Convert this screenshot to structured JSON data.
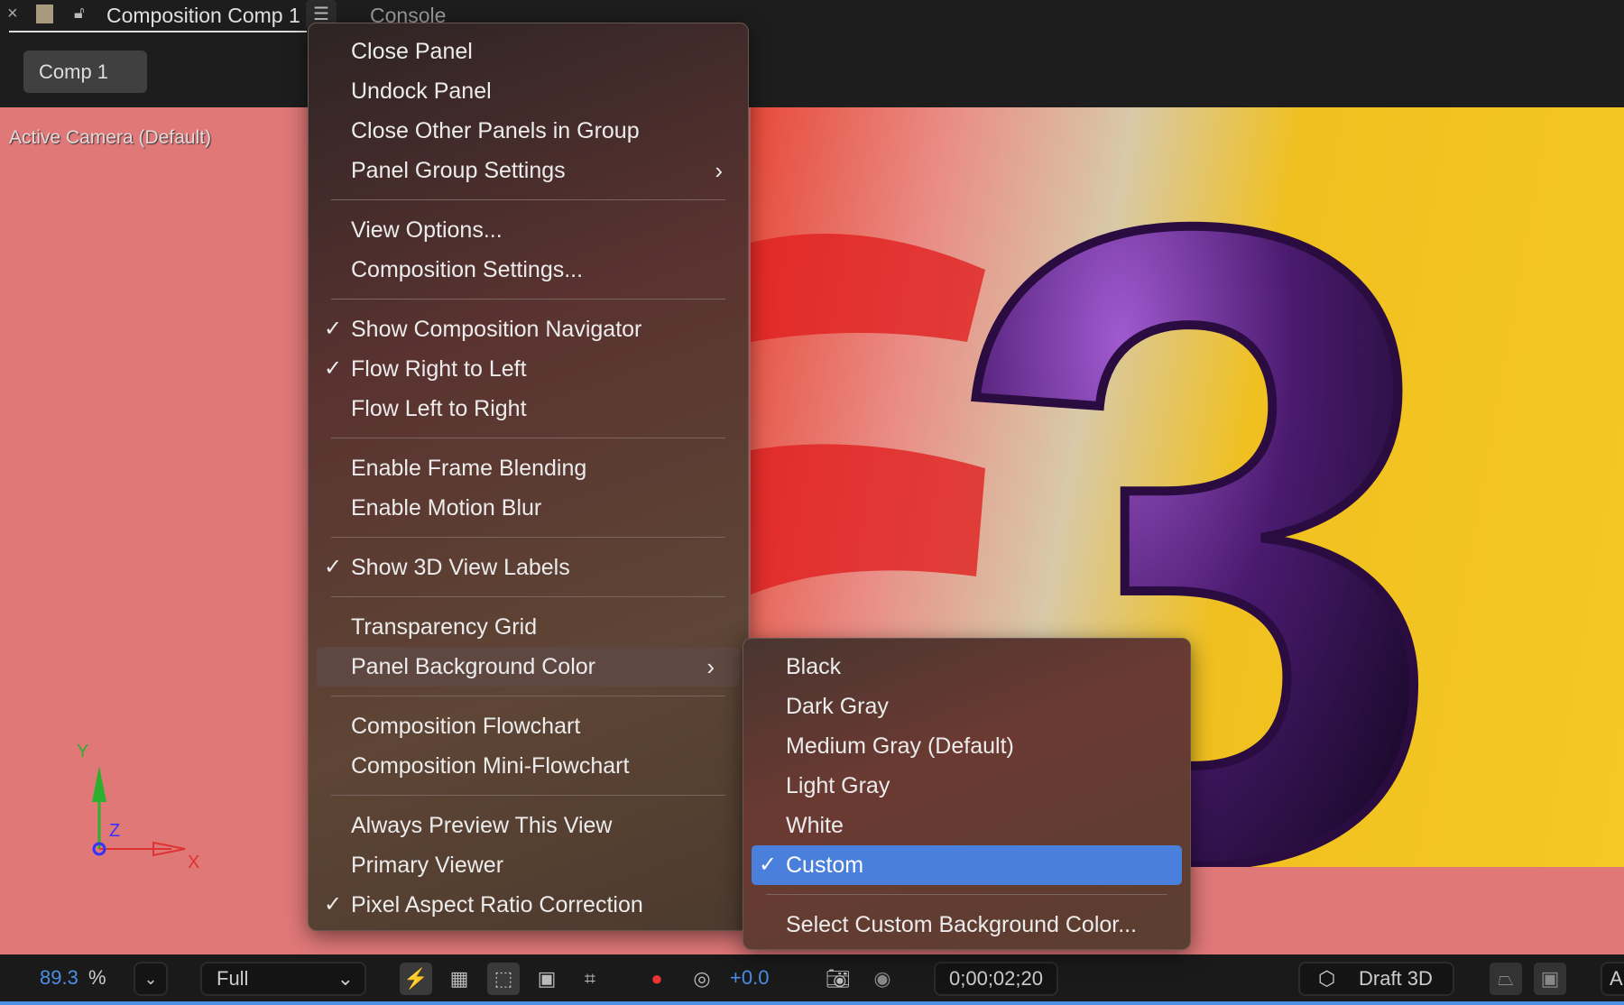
{
  "tabs": {
    "close": "×",
    "comp_tab": "Composition Comp 1",
    "menu_icon": "hamburger-icon",
    "console_tab": "Console"
  },
  "comp_button": "Comp 1",
  "viewer": {
    "camera_label": "Active Camera (Default)",
    "axes": {
      "x": "X",
      "y": "Y",
      "z": "Z"
    },
    "background_color": "#e07878"
  },
  "menu": {
    "items": [
      {
        "label": "Close Panel"
      },
      {
        "label": "Undock Panel"
      },
      {
        "label": "Close Other Panels in Group"
      },
      {
        "label": "Panel Group Settings",
        "submenu": true
      },
      {
        "label": "View Options..."
      },
      {
        "label": "Composition Settings..."
      },
      {
        "label": "Show Composition Navigator",
        "checked": true
      },
      {
        "label": "Flow Right to Left",
        "checked": true
      },
      {
        "label": "Flow Left to Right"
      },
      {
        "label": "Enable Frame Blending"
      },
      {
        "label": "Enable Motion Blur"
      },
      {
        "label": "Show 3D View Labels",
        "checked": true
      },
      {
        "label": "Transparency Grid"
      },
      {
        "label": "Panel Background Color",
        "submenu": true,
        "highlighted": true
      },
      {
        "label": "Composition Flowchart"
      },
      {
        "label": "Composition Mini-Flowchart"
      },
      {
        "label": "Always Preview This View"
      },
      {
        "label": "Primary Viewer"
      },
      {
        "label": "Pixel Aspect Ratio Correction",
        "checked": true
      }
    ]
  },
  "submenu": {
    "items": [
      {
        "label": "Black"
      },
      {
        "label": "Dark Gray"
      },
      {
        "label": "Medium Gray (Default)"
      },
      {
        "label": "Light Gray"
      },
      {
        "label": "White"
      },
      {
        "label": "Custom",
        "checked": true,
        "selected": true
      },
      {
        "label": "Select Custom Background Color..."
      }
    ]
  },
  "check_mark": "✓",
  "submenu_arrow": "›",
  "toolbar": {
    "zoom_value": "89.3",
    "zoom_unit": "%",
    "resolution": "Full",
    "exposure": "+0.0",
    "timecode": "0;00;02;20",
    "renderer": "Draft 3D",
    "cutoff": "A"
  },
  "colors": {
    "accent": "#4a7fdc",
    "highlight_blue": "#4a8ee6"
  }
}
